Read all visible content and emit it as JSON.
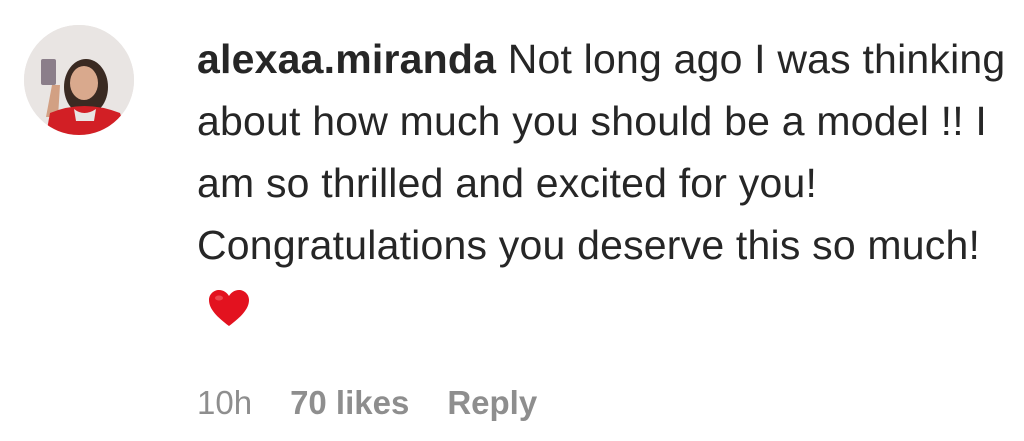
{
  "comment": {
    "username": "alexaa.miranda",
    "text": "Not long ago I was thinking about how much you should be a model !! I am so thrilled and excited for you! Congratulations you deserve this so much!",
    "emoji": "red-heart-icon",
    "colors": {
      "text": "#262626",
      "meta": "#8e8e8e",
      "heart": "#e3121f"
    }
  },
  "meta": {
    "time": "10h",
    "likes": "70 likes",
    "reply_label": "Reply"
  },
  "avatar": {
    "icon": "profile-photo"
  }
}
